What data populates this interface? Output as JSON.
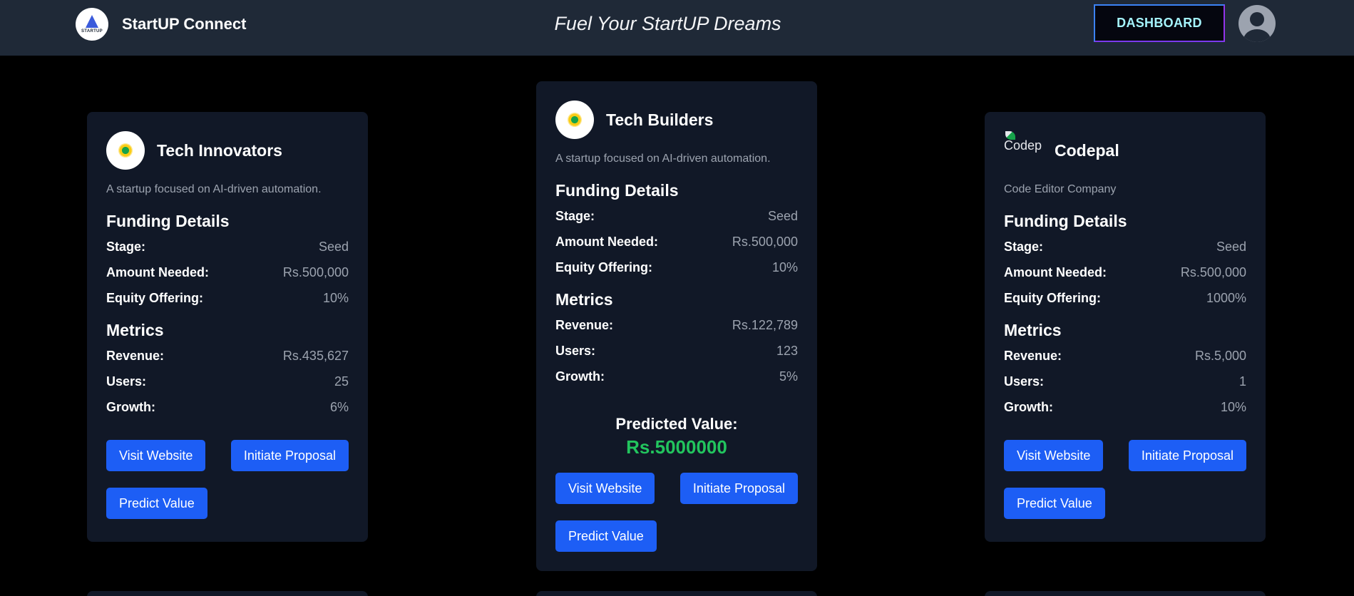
{
  "header": {
    "brand_name": "StartUP Connect",
    "logo_text": "STARTUP",
    "tagline": "Fuel Your StartUP Dreams",
    "dashboard_label": "DASHBOARD",
    "avatar_icon": "user-avatar-icon"
  },
  "colors": {
    "header_bg": "#1f2937",
    "card_bg": "#111827",
    "button": "#1d5ef5",
    "predicted_value": "#22c55e",
    "dashboard_text": "#a5f3fc"
  },
  "cards": [
    {
      "name": "Tech Innovators",
      "description": "A startup focused on AI-driven automation.",
      "funding_title": "Funding Details",
      "stage_label": "Stage:",
      "stage": "Seed",
      "amount_label": "Amount Needed:",
      "amount": "Rs.500,000",
      "equity_label": "Equity Offering:",
      "equity": "10%",
      "metrics_title": "Metrics",
      "revenue_label": "Revenue:",
      "revenue": "Rs.435,627",
      "users_label": "Users:",
      "users": "25",
      "growth_label": "Growth:",
      "growth": "6%",
      "visit_label": "Visit Website",
      "proposal_label": "Initiate Proposal",
      "predict_label": "Predict Value"
    },
    {
      "name": "Tech Builders",
      "description": "A startup focused on AI-driven automation.",
      "funding_title": "Funding Details",
      "stage_label": "Stage:",
      "stage": "Seed",
      "amount_label": "Amount Needed:",
      "amount": "Rs.500,000",
      "equity_label": "Equity Offering:",
      "equity": "10%",
      "metrics_title": "Metrics",
      "revenue_label": "Revenue:",
      "revenue": "Rs.122,789",
      "users_label": "Users:",
      "users": "123",
      "growth_label": "Growth:",
      "growth": "5%",
      "predicted_label": "Predicted Value:",
      "predicted_value": "Rs.5000000",
      "visit_label": "Visit Website",
      "proposal_label": "Initiate Proposal",
      "predict_label": "Predict Value"
    },
    {
      "name": "Codepal",
      "logo_alt": "Codep",
      "description": "Code Editor Company",
      "funding_title": "Funding Details",
      "stage_label": "Stage:",
      "stage": "Seed",
      "amount_label": "Amount Needed:",
      "amount": "Rs.500,000",
      "equity_label": "Equity Offering:",
      "equity": "1000%",
      "metrics_title": "Metrics",
      "revenue_label": "Revenue:",
      "revenue": "Rs.5,000",
      "users_label": "Users:",
      "users": "1",
      "growth_label": "Growth:",
      "growth": "10%",
      "visit_label": "Visit Website",
      "proposal_label": "Initiate Proposal",
      "predict_label": "Predict Value"
    }
  ]
}
